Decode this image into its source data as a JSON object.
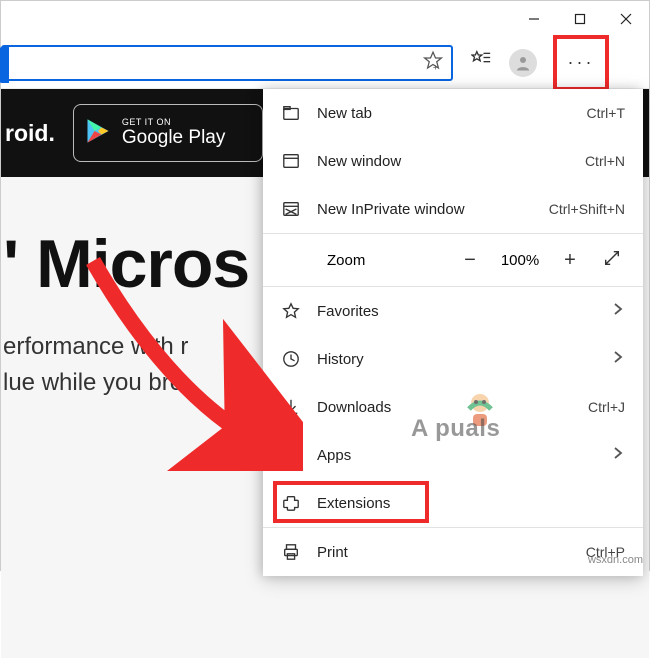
{
  "window": {
    "minimize": "—",
    "maximize": "☐",
    "close": "✕"
  },
  "toolbar": {
    "more_label": "···"
  },
  "page": {
    "roid_text": "roid.",
    "gp_small": "GET IT ON",
    "gp_big": "Google Play",
    "heading": "' Micros",
    "sub1": "erformance with r",
    "sub2": "lue while you bro"
  },
  "menu": {
    "items": [
      {
        "label": "New tab",
        "shortcut": "Ctrl+T"
      },
      {
        "label": "New window",
        "shortcut": "Ctrl+N"
      },
      {
        "label": "New InPrivate window",
        "shortcut": "Ctrl+Shift+N"
      }
    ],
    "zoom": {
      "label": "Zoom",
      "value": "100%"
    },
    "items2": [
      {
        "label": "Favorites"
      },
      {
        "label": "History"
      },
      {
        "label": "Downloads",
        "shortcut": "Ctrl+J"
      },
      {
        "label": "Apps"
      },
      {
        "label": "Extensions"
      }
    ],
    "items3": [
      {
        "label": "Print",
        "shortcut": "Ctrl+P"
      }
    ]
  },
  "annotations": {
    "highlight_more_button": true,
    "highlight_extensions_item": true,
    "red_arrow_pointing_to": "Extensions"
  },
  "watermark": {
    "site": "wsxdn.com",
    "brand": "A  puals"
  }
}
